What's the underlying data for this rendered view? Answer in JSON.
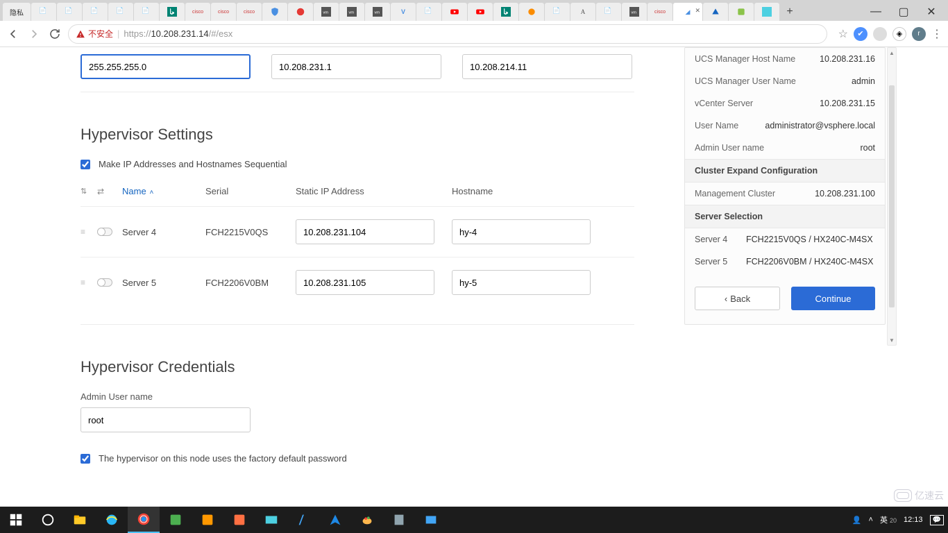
{
  "browser": {
    "tab_label_first": "隐私",
    "url_warning": "不安全",
    "url_https": "https",
    "url_host": "10.208.231.14",
    "url_path": "/#/esx",
    "avatar_letter": "r"
  },
  "top": {
    "subnet": "255.255.255.0",
    "gateway": "10.208.231.1",
    "dns": "10.208.214.11"
  },
  "headings": {
    "hypervisor_settings": "Hypervisor Settings",
    "hypervisor_credentials": "Hypervisor Credentials"
  },
  "checkboxes": {
    "sequential_label": "Make IP Addresses and Hostnames Sequential",
    "factory_pw_label": "The hypervisor on this node uses the factory default password"
  },
  "table": {
    "headers": {
      "name": "Name",
      "serial": "Serial",
      "ip": "Static IP Address",
      "hostname": "Hostname"
    },
    "rows": [
      {
        "name": "Server 4",
        "serial": "FCH2215V0QS",
        "ip": "10.208.231.104",
        "hostname": "hy-4"
      },
      {
        "name": "Server 5",
        "serial": "FCH2206V0BM",
        "ip": "10.208.231.105",
        "hostname": "hy-5"
      }
    ]
  },
  "cred": {
    "admin_user_label": "Admin User name",
    "admin_user_value": "root"
  },
  "right": {
    "ucs_host_lbl": "UCS Manager Host Name",
    "ucs_host_val": "10.208.231.16",
    "ucs_user_lbl": "UCS Manager User Name",
    "ucs_user_val": "admin",
    "vcenter_lbl": "vCenter Server",
    "vcenter_val": "10.208.231.15",
    "user_lbl": "User Name",
    "user_val": "administrator@vsphere.local",
    "admin_lbl": "Admin User name",
    "admin_val": "root",
    "cluster_head": "Cluster Expand Configuration",
    "mgmt_lbl": "Management Cluster",
    "mgmt_val": "10.208.231.100",
    "server_sel_head": "Server Selection",
    "srv4_lbl": "Server 4",
    "srv4_val": "FCH2215V0QS / HX240C-M4SX",
    "srv5_lbl": "Server 5",
    "srv5_val": "FCH2206V0BM / HX240C-M4SX",
    "back": "Back",
    "continue": "Continue"
  },
  "taskbar": {
    "ime": "英",
    "ime_num": "20",
    "time": "12:13"
  },
  "watermark": "亿速云"
}
